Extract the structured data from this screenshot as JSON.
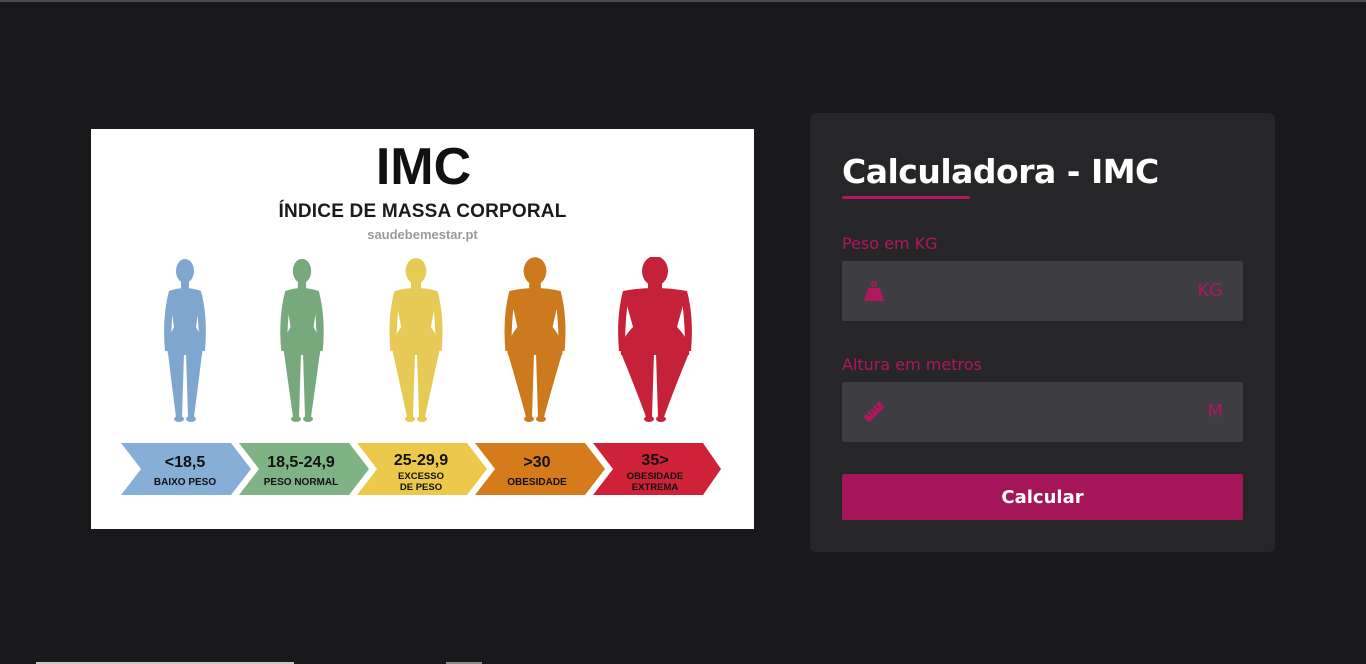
{
  "infographic": {
    "title": "IMC",
    "subtitle": "ÍNDICE DE MASSA CORPORAL",
    "source": "saudebemestar.pt",
    "categories": [
      {
        "range": "<18,5",
        "label_line1": "BAIXO PESO",
        "label_line2": "",
        "color": "#86aed6"
      },
      {
        "range": "18,5-24,9",
        "label_line1": "PESO NORMAL",
        "label_line2": "",
        "color": "#7fb285"
      },
      {
        "range": "25-29,9",
        "label_line1": "EXCESSO",
        "label_line2": "DE PESO",
        "color": "#ecc94b"
      },
      {
        "range": ">30",
        "label_line1": "OBESIDADE",
        "label_line2": "",
        "color": "#d57b1c"
      },
      {
        "range": "35>",
        "label_line1": "OBESIDADE",
        "label_line2": "EXTREMA",
        "color": "#cf2138"
      }
    ],
    "figure_colors": [
      "#7fa6cf",
      "#78a97d",
      "#e7c955",
      "#cd7a1f",
      "#c5223a"
    ]
  },
  "calculator": {
    "title": "Calculadora - IMC",
    "weight": {
      "label": "Peso em KG",
      "value": "",
      "placeholder": "",
      "unit": "KG",
      "icon": "weight-icon"
    },
    "height": {
      "label": "Altura em metros",
      "value": "",
      "placeholder": "",
      "unit": "M",
      "icon": "ruler-icon"
    },
    "button_label": "Calcular",
    "accent_color": "#b0175e"
  }
}
